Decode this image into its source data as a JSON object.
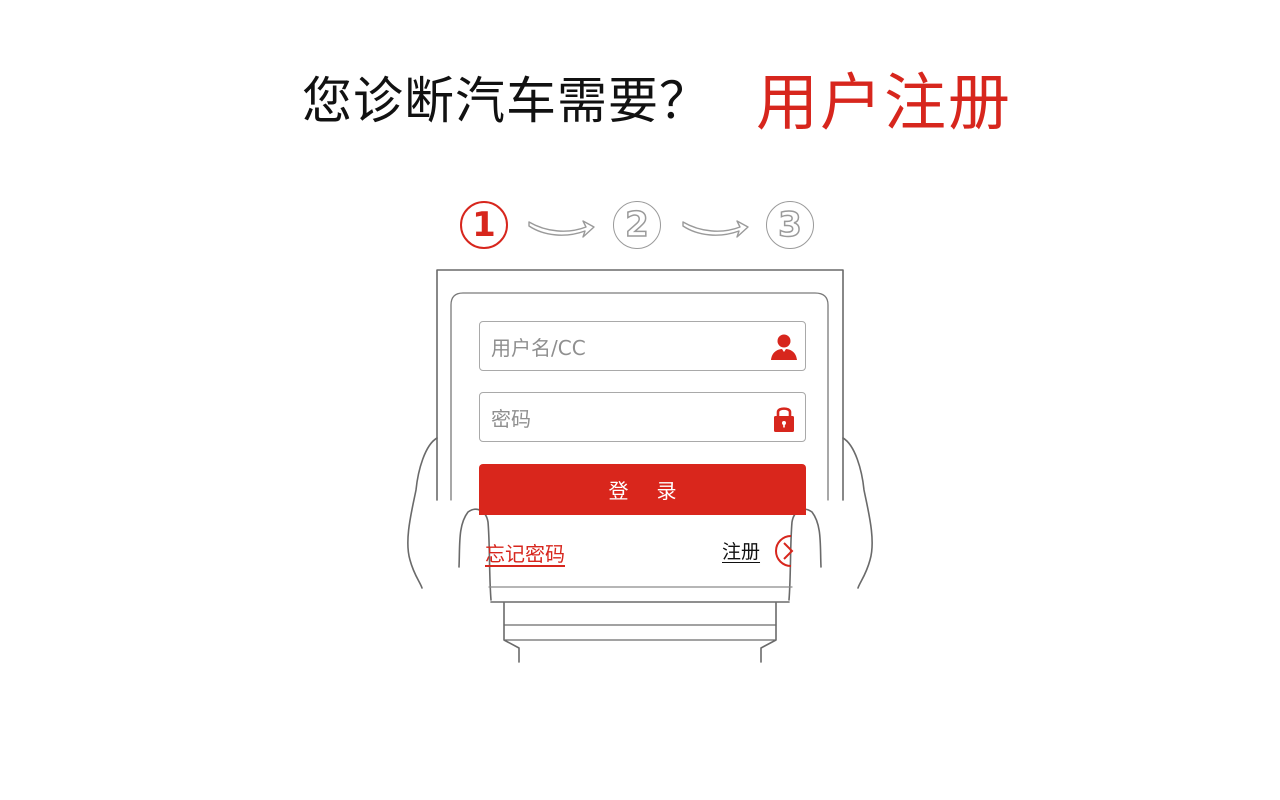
{
  "header": {
    "question": "您诊断汽车需要？",
    "title": "用户注册"
  },
  "steps": [
    {
      "label": "1",
      "state": "active"
    },
    {
      "label": "2",
      "state": "inactive"
    },
    {
      "label": "3",
      "state": "inactive"
    }
  ],
  "login_form": {
    "username_placeholder": "用户名/CC",
    "password_placeholder": "密码",
    "login_label": "登录",
    "forgot_label": "忘记密码",
    "register_label": "注册"
  },
  "colors": {
    "accent": "#d7261d",
    "text": "#111111",
    "outline": "#9a9a9a"
  },
  "icons": [
    "user-icon",
    "lock-icon",
    "arrow-right-icon",
    "circle-chevron-icon"
  ]
}
